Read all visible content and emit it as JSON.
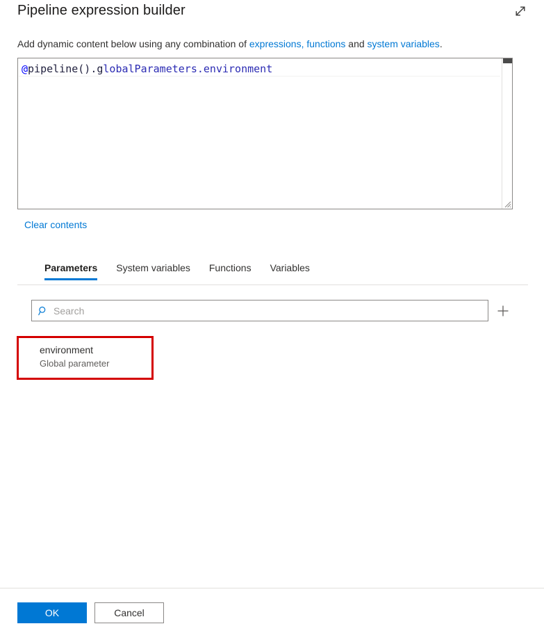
{
  "header": {
    "title": "Pipeline expression builder",
    "expand_icon": "expand-diagonal-arrows-icon"
  },
  "subtitle": {
    "part1": "Add dynamic content below using any combination of ",
    "link1": "expressions, functions",
    "part2": " and ",
    "link2": "system variables",
    "part3": "."
  },
  "editor": {
    "expression_full": "@pipeline().globalParameters.environment",
    "token_at": "@",
    "token_body": "pipeline().g",
    "token_tail": "lobalParameters.environment",
    "scrollbar_name": "vertical-scrollbar",
    "resize_grip_name": "resize-grip"
  },
  "clear_contents": {
    "label": "Clear contents"
  },
  "tabs": [
    {
      "label": "Parameters",
      "active": true
    },
    {
      "label": "System variables",
      "active": false
    },
    {
      "label": "Functions",
      "active": false
    },
    {
      "label": "Variables",
      "active": false
    }
  ],
  "search": {
    "placeholder": "Search",
    "value": "",
    "icon": "search-icon"
  },
  "add_button": {
    "icon": "plus-icon"
  },
  "parameters": [
    {
      "name": "environment",
      "description": "Global parameter"
    }
  ],
  "footer": {
    "ok_label": "OK",
    "cancel_label": "Cancel"
  },
  "colors": {
    "accent": "#0078d4",
    "link": "#0078d4",
    "annotation": "#d40000",
    "text": "#323130",
    "subtle_text": "#605e5c",
    "border": "#8a8886",
    "divider": "#e1dfdd"
  }
}
